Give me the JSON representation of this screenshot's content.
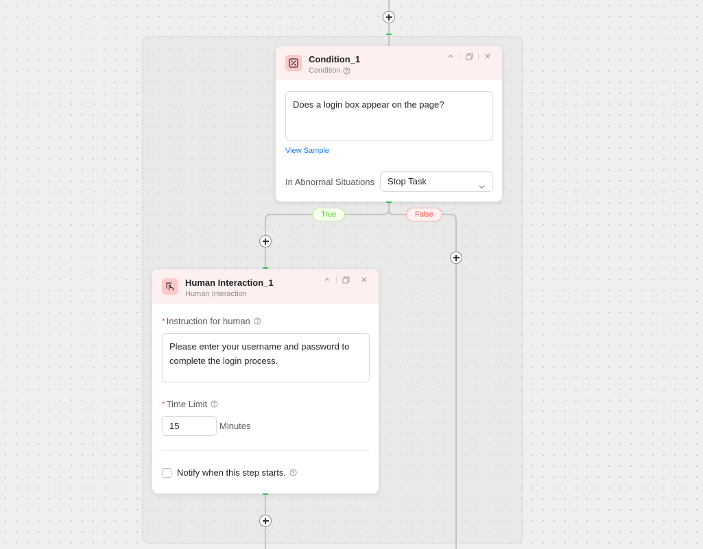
{
  "condition_node": {
    "title": "Condition_1",
    "subtitle": "Condition",
    "question": "Does a login box appear on the page?",
    "view_sample": "View Sample",
    "abnormal_label": "In Abnormal Situations",
    "abnormal_value": "Stop Task"
  },
  "branches": {
    "true_label": "True",
    "false_label": "False"
  },
  "human_node": {
    "title": "Human Interaction_1",
    "subtitle": "Human Interaction",
    "instruction_label": "Instruction for human",
    "instruction_value": "Please enter your username and password to complete the login process.",
    "time_limit_label": "Time Limit",
    "time_limit_value": "15",
    "time_unit": "Minutes",
    "notify_label": "Notify when this step starts.",
    "required_mark": "*"
  },
  "colors": {
    "accent": "#1677ff",
    "connector_green": "#34c759",
    "header_pink": "#fff0f0"
  }
}
